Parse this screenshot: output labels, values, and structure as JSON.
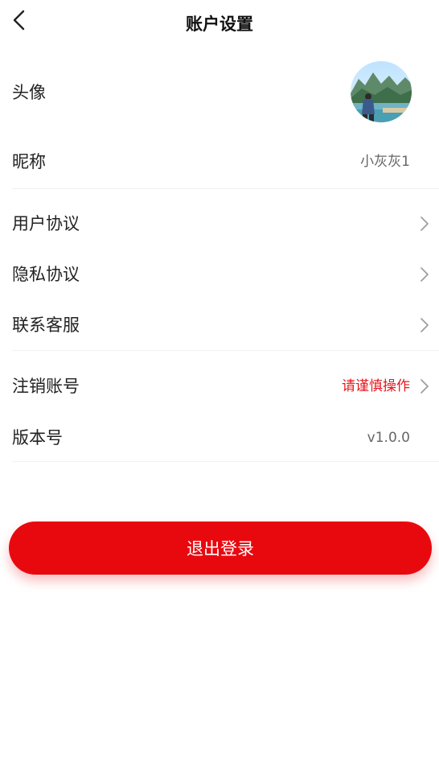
{
  "header": {
    "title": "账户设置"
  },
  "profile": {
    "avatar_label": "头像",
    "nickname_label": "昵称",
    "nickname_value": "小灰灰1"
  },
  "links": {
    "user_agreement": "用户协议",
    "privacy_agreement": "隐私协议",
    "contact_service": "联系客服"
  },
  "account": {
    "cancel_label": "注销账号",
    "cancel_value": "请谨慎操作",
    "version_label": "版本号",
    "version_value": "v1.0.0"
  },
  "logout": {
    "label": "退出登录"
  },
  "colors": {
    "accent": "#e8090f",
    "warning_text": "#e8161c"
  },
  "icons": {
    "back": "chevron-left-icon",
    "row_arrow": "chevron-right-icon"
  }
}
